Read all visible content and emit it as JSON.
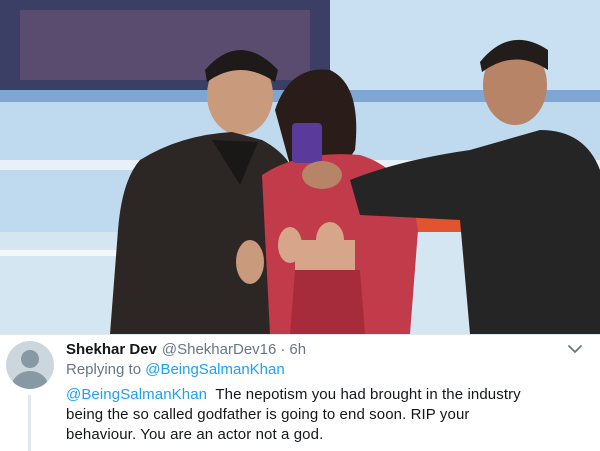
{
  "tweet": {
    "author_name": "Shekhar Dev",
    "author_handle": "@ShekharDev16",
    "separator": "·",
    "timestamp": "6h",
    "replying_label": "Replying to",
    "replying_handle": "@BeingSalmanKhan",
    "body_mention": "@BeingSalmanKhan",
    "body_line1": "The nepotism you had brought in the industry",
    "body_line2": "being the so called godfather is going to end soon. RIP your",
    "body_line3": "behaviour. You are an actor not a god.",
    "menu_icon": "chevron-down-icon",
    "avatar_icon": "default-avatar-icon"
  },
  "colors": {
    "link": "#1da1f2",
    "text_primary": "#14171a",
    "text_secondary": "#657786",
    "divider": "#e1e8ed"
  }
}
